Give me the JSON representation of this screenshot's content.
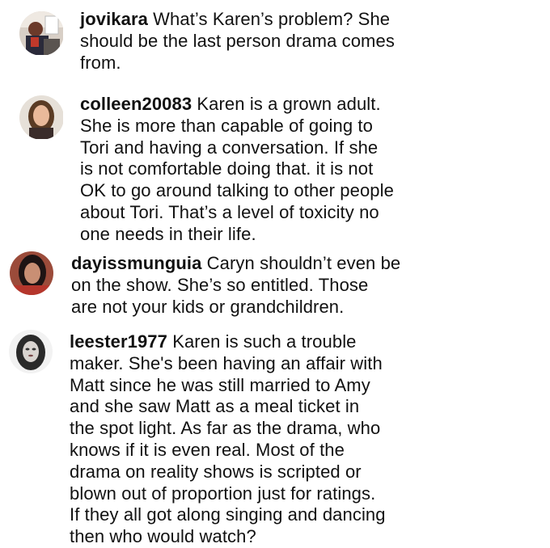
{
  "comments": [
    {
      "avatar_icon": "user-avatar-icon",
      "username": "jovikara",
      "text": " What’s Karen’s problem? She\nshould be the last person drama comes\nfrom."
    },
    {
      "avatar_icon": "user-avatar-icon",
      "username": "colleen20083",
      "text": " Karen is a grown adult.\nShe is more than capable of going to\nTori and having a conversation. If she\nis not comfortable doing that. it is not\nOK to go around talking to other people\nabout Tori. That’s a level of toxicity no\none needs in their life."
    },
    {
      "avatar_icon": "user-avatar-icon",
      "username": "dayissmunguia",
      "text": " Caryn shouldn’t even be\non the show. She’s so entitled. Those\nare not your kids or grandchildren."
    },
    {
      "avatar_icon": "user-avatar-icon",
      "username": "leester1977",
      "text": " Karen is such a trouble\nmaker. She's been having an affair with\nMatt since he was still married to Amy\nand she saw Matt as a meal ticket in\nthe spot light. As far as the drama,  who\nknows if it is even real. Most of the\ndrama on reality shows is scripted or\nblown out of proportion just for ratings.\nIf they all got along singing and dancing\nthen who would watch?"
    }
  ]
}
